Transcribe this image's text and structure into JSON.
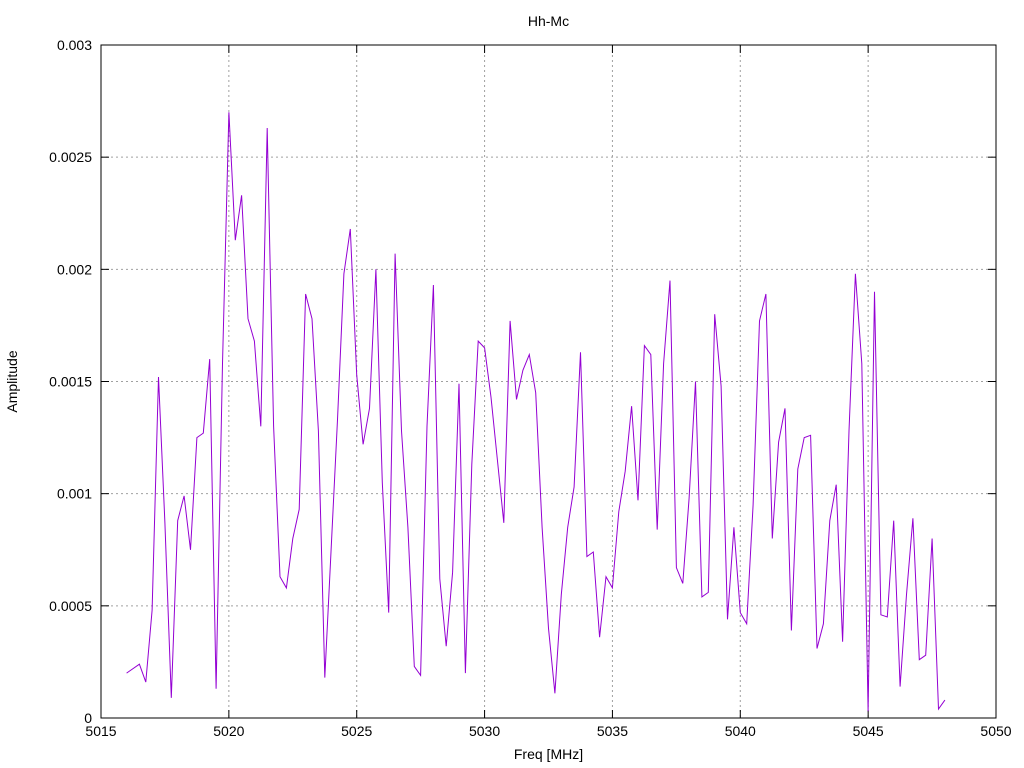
{
  "chart_data": {
    "type": "line",
    "title": "Hh-Mc",
    "xlabel": "Freq [MHz]",
    "ylabel": "Amplitude",
    "xlim": [
      5015,
      5050
    ],
    "ylim": [
      0,
      0.003
    ],
    "xticks": [
      5015,
      5020,
      5025,
      5030,
      5035,
      5040,
      5045,
      5050
    ],
    "xtick_labels": [
      "5015",
      "5020",
      "5025",
      "5030",
      "5035",
      "5040",
      "5045",
      "5050"
    ],
    "yticks": [
      0,
      0.0005,
      0.001,
      0.0015,
      0.002,
      0.0025,
      0.003
    ],
    "ytick_labels": [
      "0",
      "0.0005",
      "0.001",
      "0.0015",
      "0.002",
      "0.0025",
      "0.003"
    ],
    "grid": true,
    "series_color": "#9400d3",
    "series": [
      {
        "x": [
          5016.0,
          5016.5,
          5016.75,
          5017.0,
          5017.25,
          5017.5,
          5017.75,
          5018.0,
          5018.25,
          5018.5,
          5018.75,
          5019.0,
          5019.25,
          5019.5,
          5019.75,
          5020.0,
          5020.25,
          5020.5,
          5020.75,
          5021.0,
          5021.25,
          5021.5,
          5021.75,
          5022.0,
          5022.25,
          5022.5,
          5022.75,
          5023.0,
          5023.25,
          5023.5,
          5023.75,
          5024.0,
          5024.25,
          5024.5,
          5024.75,
          5025.0,
          5025.25,
          5025.5,
          5025.75,
          5026.0,
          5026.25,
          5026.5,
          5026.75,
          5027.0,
          5027.25,
          5027.5,
          5027.75,
          5028.0,
          5028.25,
          5028.5,
          5028.75,
          5029.0,
          5029.25,
          5029.5,
          5029.75,
          5030.0,
          5030.25,
          5030.5,
          5030.75,
          5031.0,
          5031.25,
          5031.5,
          5031.75,
          5032.0,
          5032.25,
          5032.5,
          5032.75,
          5033.0,
          5033.25,
          5033.5,
          5033.75,
          5034.0,
          5034.25,
          5034.5,
          5034.75,
          5035.0,
          5035.25,
          5035.5,
          5035.75,
          5036.0,
          5036.25,
          5036.5,
          5036.75,
          5037.0,
          5037.25,
          5037.5,
          5037.75,
          5038.0,
          5038.25,
          5038.5,
          5038.75,
          5039.0,
          5039.25,
          5039.5,
          5039.75,
          5040.0,
          5040.25,
          5040.5,
          5040.75,
          5041.0,
          5041.25,
          5041.5,
          5041.75,
          5042.0,
          5042.25,
          5042.5,
          5042.75,
          5043.0,
          5043.25,
          5043.5,
          5043.75,
          5044.0,
          5044.25,
          5044.5,
          5044.75,
          5045.0,
          5045.25,
          5045.5,
          5045.75,
          5046.0,
          5046.25,
          5046.5,
          5046.75,
          5047.0,
          5047.25,
          5047.5,
          5047.75,
          5048.0
        ],
        "y": [
          0.0002,
          0.00024,
          0.00016,
          0.00048,
          0.00152,
          0.00087,
          9e-05,
          0.00088,
          0.00099,
          0.00075,
          0.00125,
          0.00127,
          0.0016,
          0.00013,
          0.00158,
          0.0027,
          0.00213,
          0.00233,
          0.00178,
          0.00168,
          0.0013,
          0.00263,
          0.0013,
          0.00063,
          0.00058,
          0.0008,
          0.00093,
          0.00189,
          0.00178,
          0.00128,
          0.00018,
          0.00075,
          0.00133,
          0.00198,
          0.00218,
          0.00153,
          0.00122,
          0.00138,
          0.002,
          0.00105,
          0.00047,
          0.00207,
          0.00128,
          0.00085,
          0.00023,
          0.00019,
          0.0013,
          0.00193,
          0.00062,
          0.00032,
          0.00065,
          0.00149,
          0.0002,
          0.00113,
          0.00168,
          0.00165,
          0.00143,
          0.00115,
          0.00087,
          0.00177,
          0.00142,
          0.00155,
          0.00162,
          0.00145,
          0.00085,
          0.0004,
          0.00011,
          0.00055,
          0.00085,
          0.00103,
          0.00163,
          0.00072,
          0.00074,
          0.00036,
          0.00063,
          0.00058,
          0.00092,
          0.0011,
          0.00139,
          0.00097,
          0.00166,
          0.00162,
          0.00084,
          0.00158,
          0.00195,
          0.00067,
          0.0006,
          0.00098,
          0.0015,
          0.00054,
          0.00056,
          0.0018,
          0.00148,
          0.00044,
          0.00085,
          0.00047,
          0.00042,
          0.00095,
          0.00177,
          0.00189,
          0.0008,
          0.00123,
          0.00138,
          0.00039,
          0.00111,
          0.00125,
          0.00126,
          0.00031,
          0.00042,
          0.00088,
          0.00104,
          0.00034,
          0.00128,
          0.00198,
          0.00158,
          3e-05,
          0.0019,
          0.00046,
          0.00045,
          0.00088,
          0.00014,
          0.00055,
          0.00089,
          0.00026,
          0.00028,
          0.0008,
          4e-05,
          8e-05
        ]
      }
    ]
  }
}
